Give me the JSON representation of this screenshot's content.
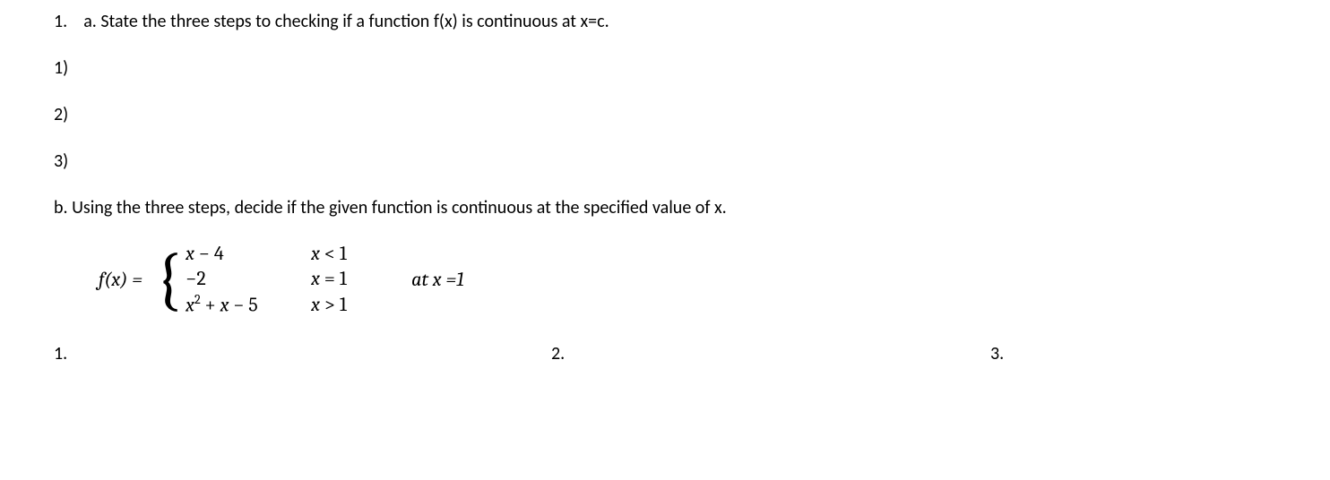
{
  "q1": {
    "number": "1.",
    "partA": {
      "label": "a. State the three steps to checking if a function f(x) is continuous at x=c.",
      "step1": "1)",
      "step2": "2)",
      "step3": "3)"
    },
    "partB": {
      "label": "b. Using the three steps, decide if the given function is continuous at the specified value of x.",
      "fx": "f(x) =",
      "cases": [
        {
          "expr_pre": "x ",
          "expr_op": "−",
          "expr_post": " 4",
          "cond_var": "x",
          "cond_rel": " < ",
          "cond_val": "1"
        },
        {
          "expr_pre": "",
          "expr_op": "−",
          "expr_post": "2",
          "cond_var": "x",
          "cond_rel": " = ",
          "cond_val": "1"
        },
        {
          "expr_pre": "x",
          "expr_sup": "2",
          "expr_op2": " + ",
          "expr_mid": "x",
          "expr_op3": " − ",
          "expr_post": "5",
          "cond_var": "x",
          "cond_rel": " > ",
          "cond_val": "1"
        }
      ],
      "at": "at x =1",
      "ans1": "1.",
      "ans2": "2.",
      "ans3": "3."
    }
  }
}
